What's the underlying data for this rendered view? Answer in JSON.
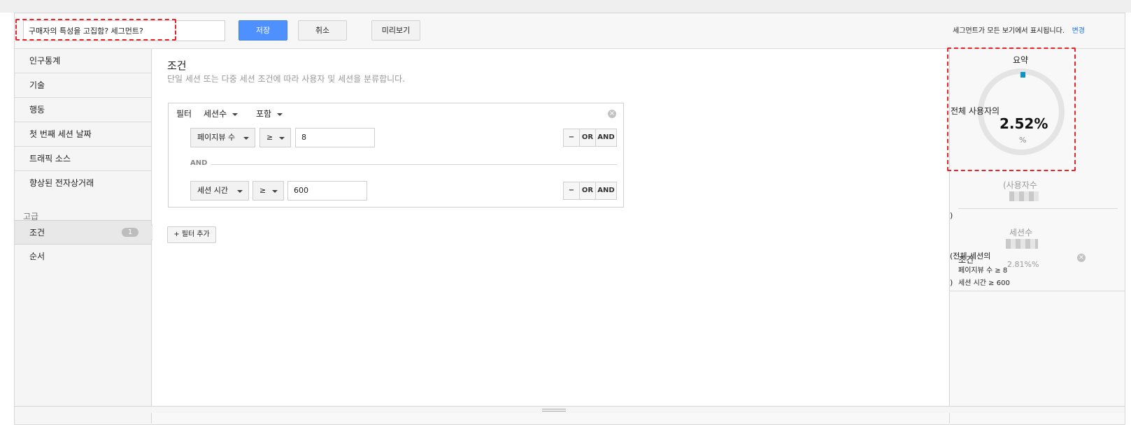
{
  "toolbar": {
    "segment_name": "구매자의 특성을 고집함? 세그먼트?",
    "save_label": "저장",
    "cancel_label": "취소",
    "preview_label": "미리보기",
    "notice": "세그먼트가 모든 보기에서 표시됩니다.",
    "change_link": "변경"
  },
  "sidebar": {
    "items": [
      {
        "label": "인구통계"
      },
      {
        "label": "기술"
      },
      {
        "label": "행동"
      },
      {
        "label": "첫 번째 세션 날짜"
      },
      {
        "label": "트래픽 소스"
      },
      {
        "label": "향상된 전자상거래"
      }
    ],
    "section_label": "고급",
    "advanced_items": [
      {
        "label": "조건",
        "badge": "1"
      },
      {
        "label": "순서"
      }
    ]
  },
  "main": {
    "title": "조건",
    "subtitle": "단일 세션 또는 다중 세션 조건에 따라 사용자 및 세션을 분류합니다.",
    "filter": {
      "label": "필터",
      "scope": "세션수",
      "mode": "포함",
      "rows": [
        {
          "dimension": "페이지뷰 수",
          "operator": "≥",
          "value": "8"
        },
        {
          "dimension": "세션 시간",
          "operator": "≥",
          "value": "600"
        }
      ],
      "and_separator": "AND",
      "minus_label": "−",
      "or_label": "OR",
      "and_label": "AND"
    },
    "add_filter_label": "+ 필터 추가"
  },
  "summary": {
    "title": "요약",
    "ring_label": "전체 사용자의",
    "percent": "2.52%",
    "unit": "%",
    "ring_fill_percent": 2.52,
    "users_label": "(사용자수",
    "paren_close": ")",
    "sessions_label": "세션수",
    "sessions_paren": "(전체 세션의",
    "sessions_percent": "2.81%%",
    "conditions_label": "조건",
    "condition_lines": [
      "페이지뷰 수 ≥ 8",
      "세션 시간 ≥ 600"
    ],
    "condition_close": ")"
  },
  "colors": {
    "accent": "#4d90fe",
    "highlight": "#e4262a",
    "ring_mark": "#0a93c9"
  }
}
